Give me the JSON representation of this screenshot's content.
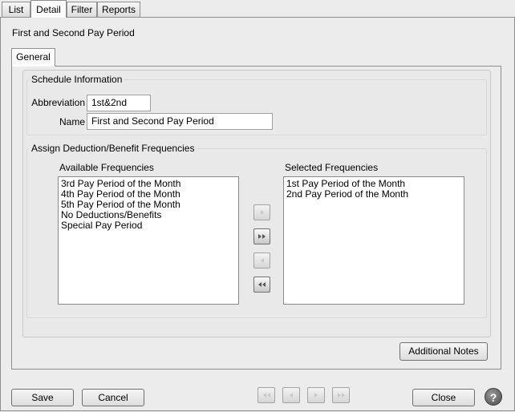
{
  "tabs": [
    {
      "label": "List",
      "active": false
    },
    {
      "label": "Detail",
      "active": true
    },
    {
      "label": "Filter",
      "active": false
    },
    {
      "label": "Reports",
      "active": false
    }
  ],
  "page_title": "First and Second Pay Period",
  "inner_tab": {
    "label": "General"
  },
  "schedule": {
    "title": "Schedule Information",
    "abbreviation_label": "Abbreviation",
    "abbreviation_value": "1st&2nd",
    "name_label": "Name",
    "name_value": "First and Second Pay Period"
  },
  "frequencies": {
    "title": "Assign Deduction/Benefit Frequencies",
    "available_label": "Available Frequencies",
    "available_items": [
      "3rd Pay Period of the Month",
      "4th Pay Period of the Month",
      "5th Pay Period of the Month",
      "No Deductions/Benefits",
      "Special Pay Period"
    ],
    "selected_label": "Selected Frequencies",
    "selected_items": [
      "1st Pay Period of the Month",
      "2nd Pay Period of the Month"
    ]
  },
  "buttons": {
    "additional_notes": "Additional Notes",
    "save": "Save",
    "cancel": "Cancel",
    "close": "Close",
    "help": "?"
  },
  "icons": {
    "move_right": "move-right-icon",
    "move_all_right": "move-all-right-icon",
    "move_left": "move-left-icon",
    "move_all_left": "move-all-left-icon",
    "nav_first": "first-record-icon",
    "nav_prev": "previous-record-icon",
    "nav_next": "next-record-icon",
    "nav_last": "last-record-icon"
  }
}
